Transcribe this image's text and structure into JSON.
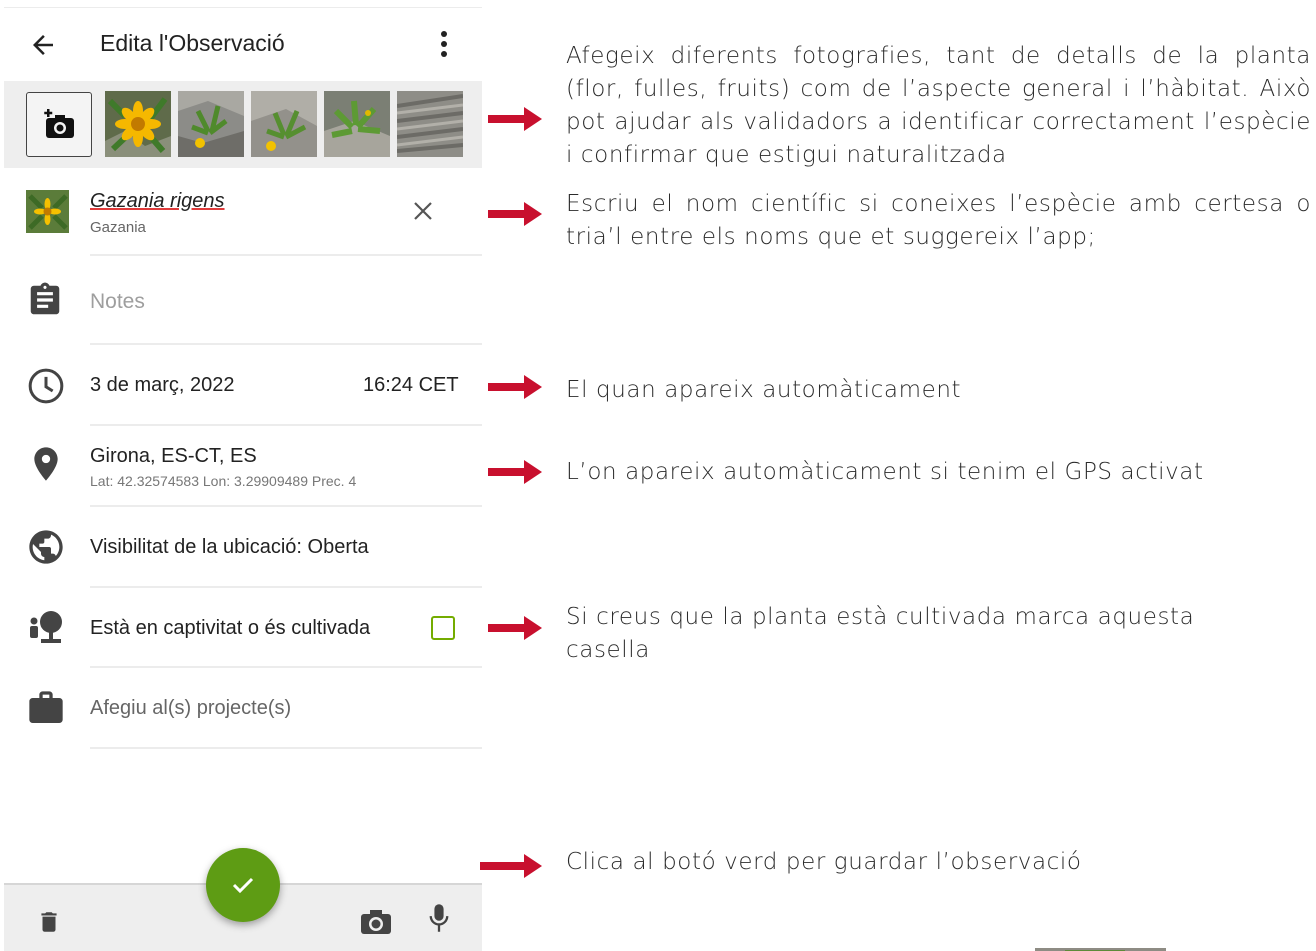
{
  "app_bar": {
    "title": "Edita l'Observació",
    "back_icon": "arrow-left-icon",
    "menu_icon": "more-vertical-icon"
  },
  "photos": {
    "add_icon": "add-photo-camera-icon",
    "thumbnails": [
      "flower-photo-1",
      "plant-photo-2",
      "plant-photo-3",
      "plant-photo-4",
      "rock-photo-5"
    ]
  },
  "species": {
    "scientific_name": "Gazania rigens",
    "common_name": "Gazania",
    "clear_icon": "close-icon"
  },
  "notes": {
    "placeholder": "Notes"
  },
  "datetime": {
    "date": "3 de març, 2022",
    "time": "16:24 CET"
  },
  "location": {
    "place": "Girona, ES-CT, ES",
    "coordinates": "Lat: 42.32574583 Lon: 3.29909489 Prec. 4"
  },
  "visibility": {
    "label": "Visibilitat de la ubicació: Oberta"
  },
  "captive": {
    "label": "Està en captivitat o és cultivada",
    "checked": false
  },
  "projects": {
    "label": "Afegiu al(s) projecte(s)"
  },
  "bottom_bar": {
    "icons": [
      "trash-icon",
      "camera-icon",
      "microphone-icon"
    ],
    "fab_icon": "check-icon"
  },
  "colors": {
    "accent_green": "#74ac00",
    "fab_green": "#5e9c14",
    "arrow_red": "#c8102e"
  },
  "annotations": [
    "Afegeix diferents fotografies, tant de detalls de la planta (flor, fulles, fruits) com de l’aspecte general i l’hàbitat. Això pot ajudar als validadors a identificar correctament l’espècie i confirmar que estigui naturalitzada",
    "Escriu el nom científic si coneixes l’espècie amb certesa o tria’l entre els noms que et suggereix l’app;",
    "El quan apareix automàticament",
    "L’on apareix automàticament si tenim el GPS activat",
    "Si creus que la planta està cultivada marca aquesta casella",
    "Clica al botó verd per guardar l’observació"
  ]
}
